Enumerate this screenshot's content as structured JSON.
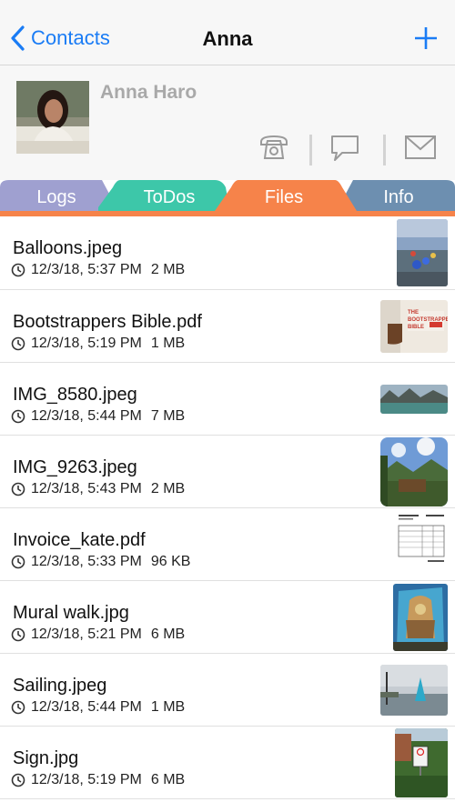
{
  "nav": {
    "back_label": "Contacts",
    "title": "Anna",
    "add_icon": "plus-icon"
  },
  "contact": {
    "name": "Anna Haro",
    "actions": [
      "phone-icon",
      "message-icon",
      "mail-icon"
    ]
  },
  "tabs": [
    {
      "label": "Logs",
      "color": "#9fa0d0",
      "active": false
    },
    {
      "label": "ToDos",
      "color": "#3dc7a9",
      "active": false
    },
    {
      "label": "Files",
      "color": "#f6834a",
      "active": true
    },
    {
      "label": "Info",
      "color": "#6d8fb0",
      "active": false
    }
  ],
  "accent_color": "#1a7cf5",
  "files": [
    {
      "name": "Balloons.jpeg",
      "date": "12/3/18, 5:37 PM",
      "size": "2 MB",
      "thumb": "balloons-thumbnail"
    },
    {
      "name": "Bootstrappers Bible.pdf",
      "date": "12/3/18, 5:19 PM",
      "size": "1 MB",
      "thumb": "book-cover-thumbnail",
      "thumb_text": "THE BOOTSTRAPPER'S BIBLE"
    },
    {
      "name": "IMG_8580.jpeg",
      "date": "12/3/18, 5:44 PM",
      "size": "7 MB",
      "thumb": "lake-thumbnail"
    },
    {
      "name": "IMG_9263.jpeg",
      "date": "12/3/18, 5:43 PM",
      "size": "2 MB",
      "thumb": "mountain-patio-thumbnail"
    },
    {
      "name": "Invoice_kate.pdf",
      "date": "12/3/18, 5:33 PM",
      "size": "96 KB",
      "thumb": "invoice-thumbnail"
    },
    {
      "name": "Mural walk.jpg",
      "date": "12/3/18, 5:21 PM",
      "size": "6 MB",
      "thumb": "mural-thumbnail"
    },
    {
      "name": "Sailing.jpeg",
      "date": "12/3/18, 5:44 PM",
      "size": "1 MB",
      "thumb": "sailing-thumbnail"
    },
    {
      "name": "Sign.jpg",
      "date": "12/3/18, 5:19 PM",
      "size": "6 MB",
      "thumb": "sign-thumbnail"
    }
  ]
}
